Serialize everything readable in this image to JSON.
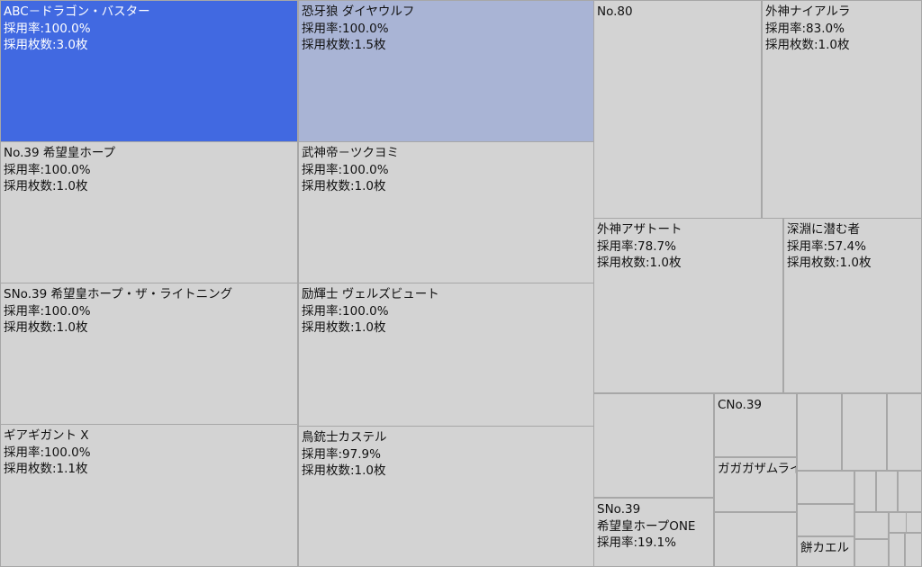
{
  "chart_data": {
    "type": "treemap",
    "colors": {
      "top": "#4169e1",
      "second": "#a9b4d5",
      "default": "#d3d3d3",
      "border": "#a7a7a7"
    },
    "cells": [
      {
        "name": "ABC－ドラゴン・バスター",
        "rate": "採用率:100.0%",
        "count": "採用枚数:3.0枚",
        "color": "#4169e1"
      },
      {
        "name": "恐牙狼 ダイヤウルフ",
        "rate": "採用率:100.0%",
        "count": "採用枚数:1.5枚",
        "color": "#a9b4d5"
      },
      {
        "name": "No.80",
        "rate": "",
        "count": ""
      },
      {
        "name": "外神ナイアルラ",
        "rate": "採用率:83.0%",
        "count": "採用枚数:1.0枚"
      },
      {
        "name": "No.39 希望皇ホープ",
        "rate": "採用率:100.0%",
        "count": "採用枚数:1.0枚"
      },
      {
        "name": "武神帝－ツクヨミ",
        "rate": "採用率:100.0%",
        "count": "採用枚数:1.0枚"
      },
      {
        "name": "外神アザトート",
        "rate": "採用率:78.7%",
        "count": "採用枚数:1.0枚"
      },
      {
        "name": "深淵に潜む者",
        "rate": "採用率:57.4%",
        "count": "採用枚数:1.0枚"
      },
      {
        "name": "SNo.39 希望皇ホープ・ザ・ライトニング",
        "rate": "採用率:100.0%",
        "count": "採用枚数:1.0枚"
      },
      {
        "name": "励輝士 ヴェルズビュート",
        "rate": "採用率:100.0%",
        "count": "採用枚数:1.0枚"
      },
      {
        "name": "ギアギガント X",
        "rate": "採用率:100.0%",
        "count": "採用枚数:1.1枚"
      },
      {
        "name": "鳥銃士カステル",
        "rate": "採用率:97.9%",
        "count": "採用枚数:1.0枚"
      },
      {
        "name": "SNo.39",
        "name2": "希望皇ホープONE",
        "rate": "採用率:19.1%",
        "count": ""
      },
      {
        "name": "CNo.39",
        "rate": "",
        "count": ""
      },
      {
        "name": "ガガガザムライ",
        "rate": "",
        "count": ""
      },
      {
        "name": "餅カエル",
        "rate": "",
        "count": ""
      },
      {
        "name": "",
        "rate": "",
        "count": ""
      },
      {
        "name": "",
        "rate": "",
        "count": ""
      },
      {
        "name": "",
        "rate": "",
        "count": ""
      },
      {
        "name": "",
        "rate": "",
        "count": ""
      },
      {
        "name": "",
        "rate": "",
        "count": ""
      },
      {
        "name": "",
        "rate": "",
        "count": ""
      },
      {
        "name": "",
        "rate": "",
        "count": ""
      },
      {
        "name": "",
        "rate": "",
        "count": ""
      },
      {
        "name": "",
        "rate": "",
        "count": ""
      },
      {
        "name": "",
        "rate": "",
        "count": ""
      },
      {
        "name": "",
        "rate": "",
        "count": ""
      },
      {
        "name": "",
        "rate": "",
        "count": ""
      },
      {
        "name": "",
        "rate": "",
        "count": ""
      },
      {
        "name": "",
        "rate": "",
        "count": ""
      },
      {
        "name": "",
        "rate": "",
        "count": ""
      },
      {
        "name": "",
        "rate": "",
        "count": ""
      },
      {
        "name": "",
        "rate": "",
        "count": ""
      }
    ]
  }
}
